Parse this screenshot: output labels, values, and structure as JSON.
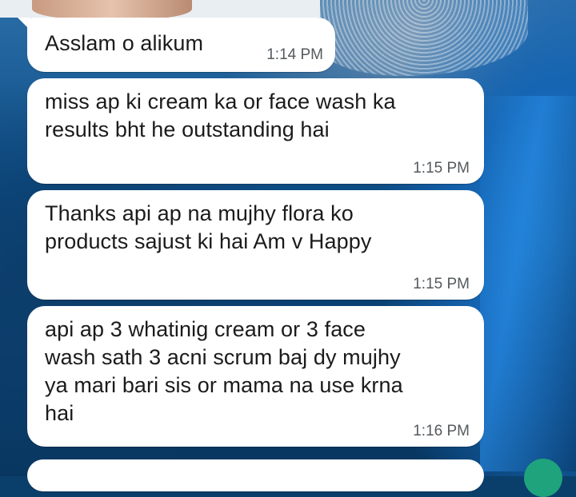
{
  "chat": {
    "messages": [
      {
        "text": "Asslam o alikum",
        "time": "1:14 PM"
      },
      {
        "text": "miss ap ki cream ka or face wash ka\nresults bht he outstanding hai",
        "time": "1:15 PM"
      },
      {
        "text": "Thanks api ap na mujhy flora ko\nproducts sajust ki hai Am v Happy",
        "time": "1:15 PM"
      },
      {
        "text": "api ap 3 whatinig cream or 3 face\nwash sath 3 acni scrum baj dy mujhy\nya mari bari sis or mama na use krna\nhai",
        "time": "1:16 PM"
      }
    ]
  },
  "colors": {
    "bubble": "#ffffff",
    "text": "#1b1b1b",
    "timestamp": "#555a5e",
    "fab": "#1fa37c"
  }
}
